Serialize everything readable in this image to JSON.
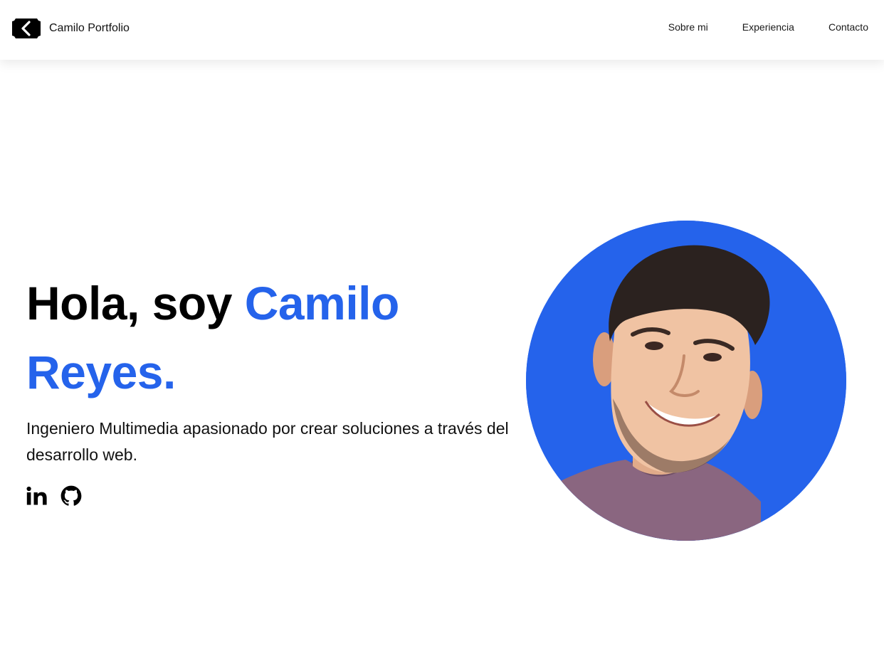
{
  "brand": {
    "name": "Camilo Portfolio",
    "logo_icon": "chevron-left-badge-icon"
  },
  "nav": {
    "items": [
      {
        "label": "Sobre mi"
      },
      {
        "label": "Experiencia"
      },
      {
        "label": "Contacto"
      }
    ]
  },
  "hero": {
    "greeting": "Hola, soy ",
    "name": "Camilo Reyes.",
    "subtitle": "Ingeniero Multimedia apasionado por crear soluciones a través del desarrollo web.",
    "accent_color": "#2563eb"
  },
  "social": {
    "items": [
      {
        "icon": "linkedin-icon"
      },
      {
        "icon": "github-icon"
      }
    ]
  },
  "portrait": {
    "icon": "profile-photo",
    "background_color": "#2563eb"
  }
}
